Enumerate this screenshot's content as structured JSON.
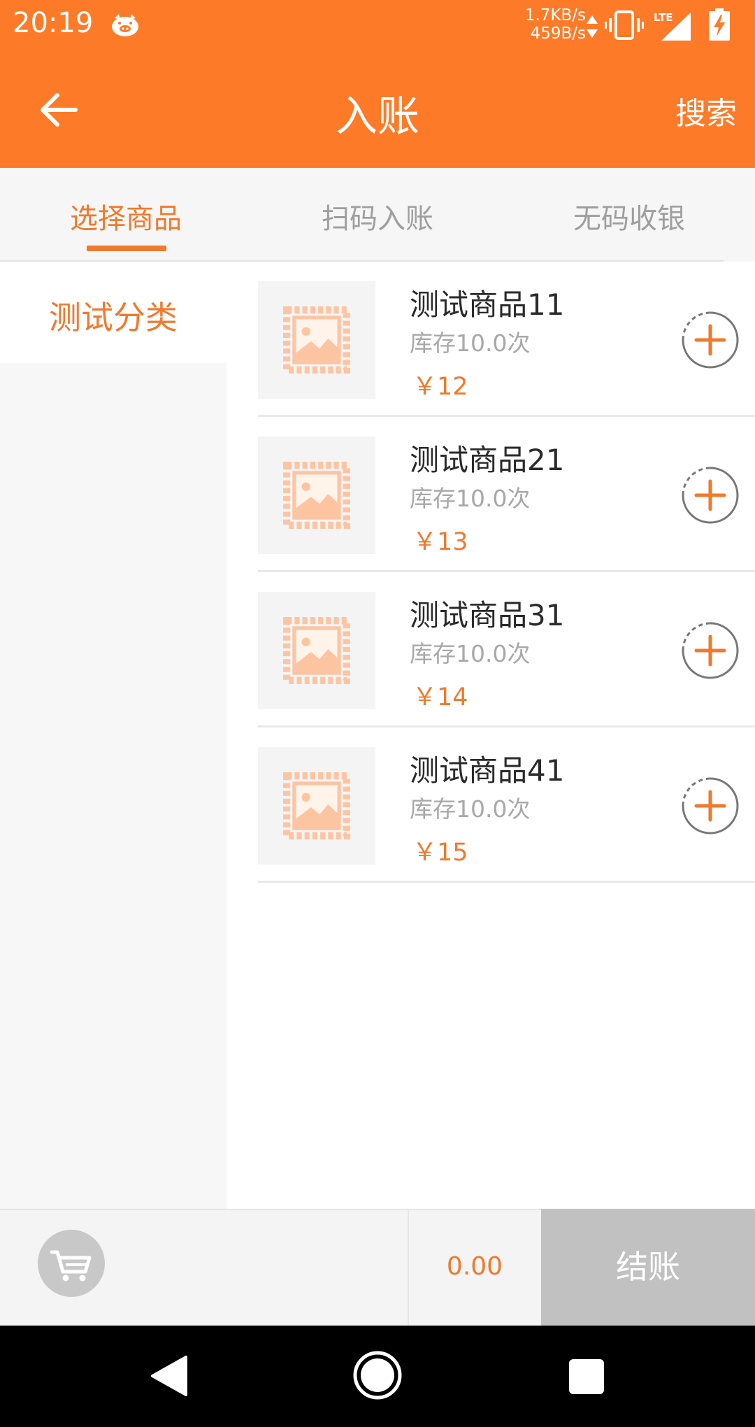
{
  "status_bar": {
    "time": "20:19",
    "net_up": "1.7KB/s",
    "net_down": "459B/s",
    "network": "LTE",
    "icons": [
      "pig-notification-icon",
      "vibrate-icon",
      "lte-signal-icon",
      "battery-charging-icon"
    ]
  },
  "app_bar": {
    "title": "入账",
    "search_label": "搜索",
    "back_icon": "arrow-left-icon"
  },
  "tabs": [
    {
      "label": "选择商品",
      "active": true
    },
    {
      "label": "扫码入账",
      "active": false
    },
    {
      "label": "无码收银",
      "active": false
    }
  ],
  "sidebar": {
    "categories": [
      {
        "label": "测试分类",
        "selected": true
      }
    ]
  },
  "products": [
    {
      "name": "测试商品11",
      "stock": "库存10.0次",
      "price": "￥12"
    },
    {
      "name": "测试商品21",
      "stock": "库存10.0次",
      "price": "￥13"
    },
    {
      "name": "测试商品31",
      "stock": "库存10.0次",
      "price": "￥14"
    },
    {
      "name": "测试商品41",
      "stock": "库存10.0次",
      "price": "￥15"
    }
  ],
  "bottom_bar": {
    "cart_icon": "cart-icon",
    "total": "0.00",
    "checkout_label": "结账"
  },
  "colors": {
    "brand": "#FD7B28",
    "accent_text": "#EF7A2D",
    "checkout_disabled": "#C2C1C1",
    "placeholder_icon": "#FDC4A2"
  }
}
